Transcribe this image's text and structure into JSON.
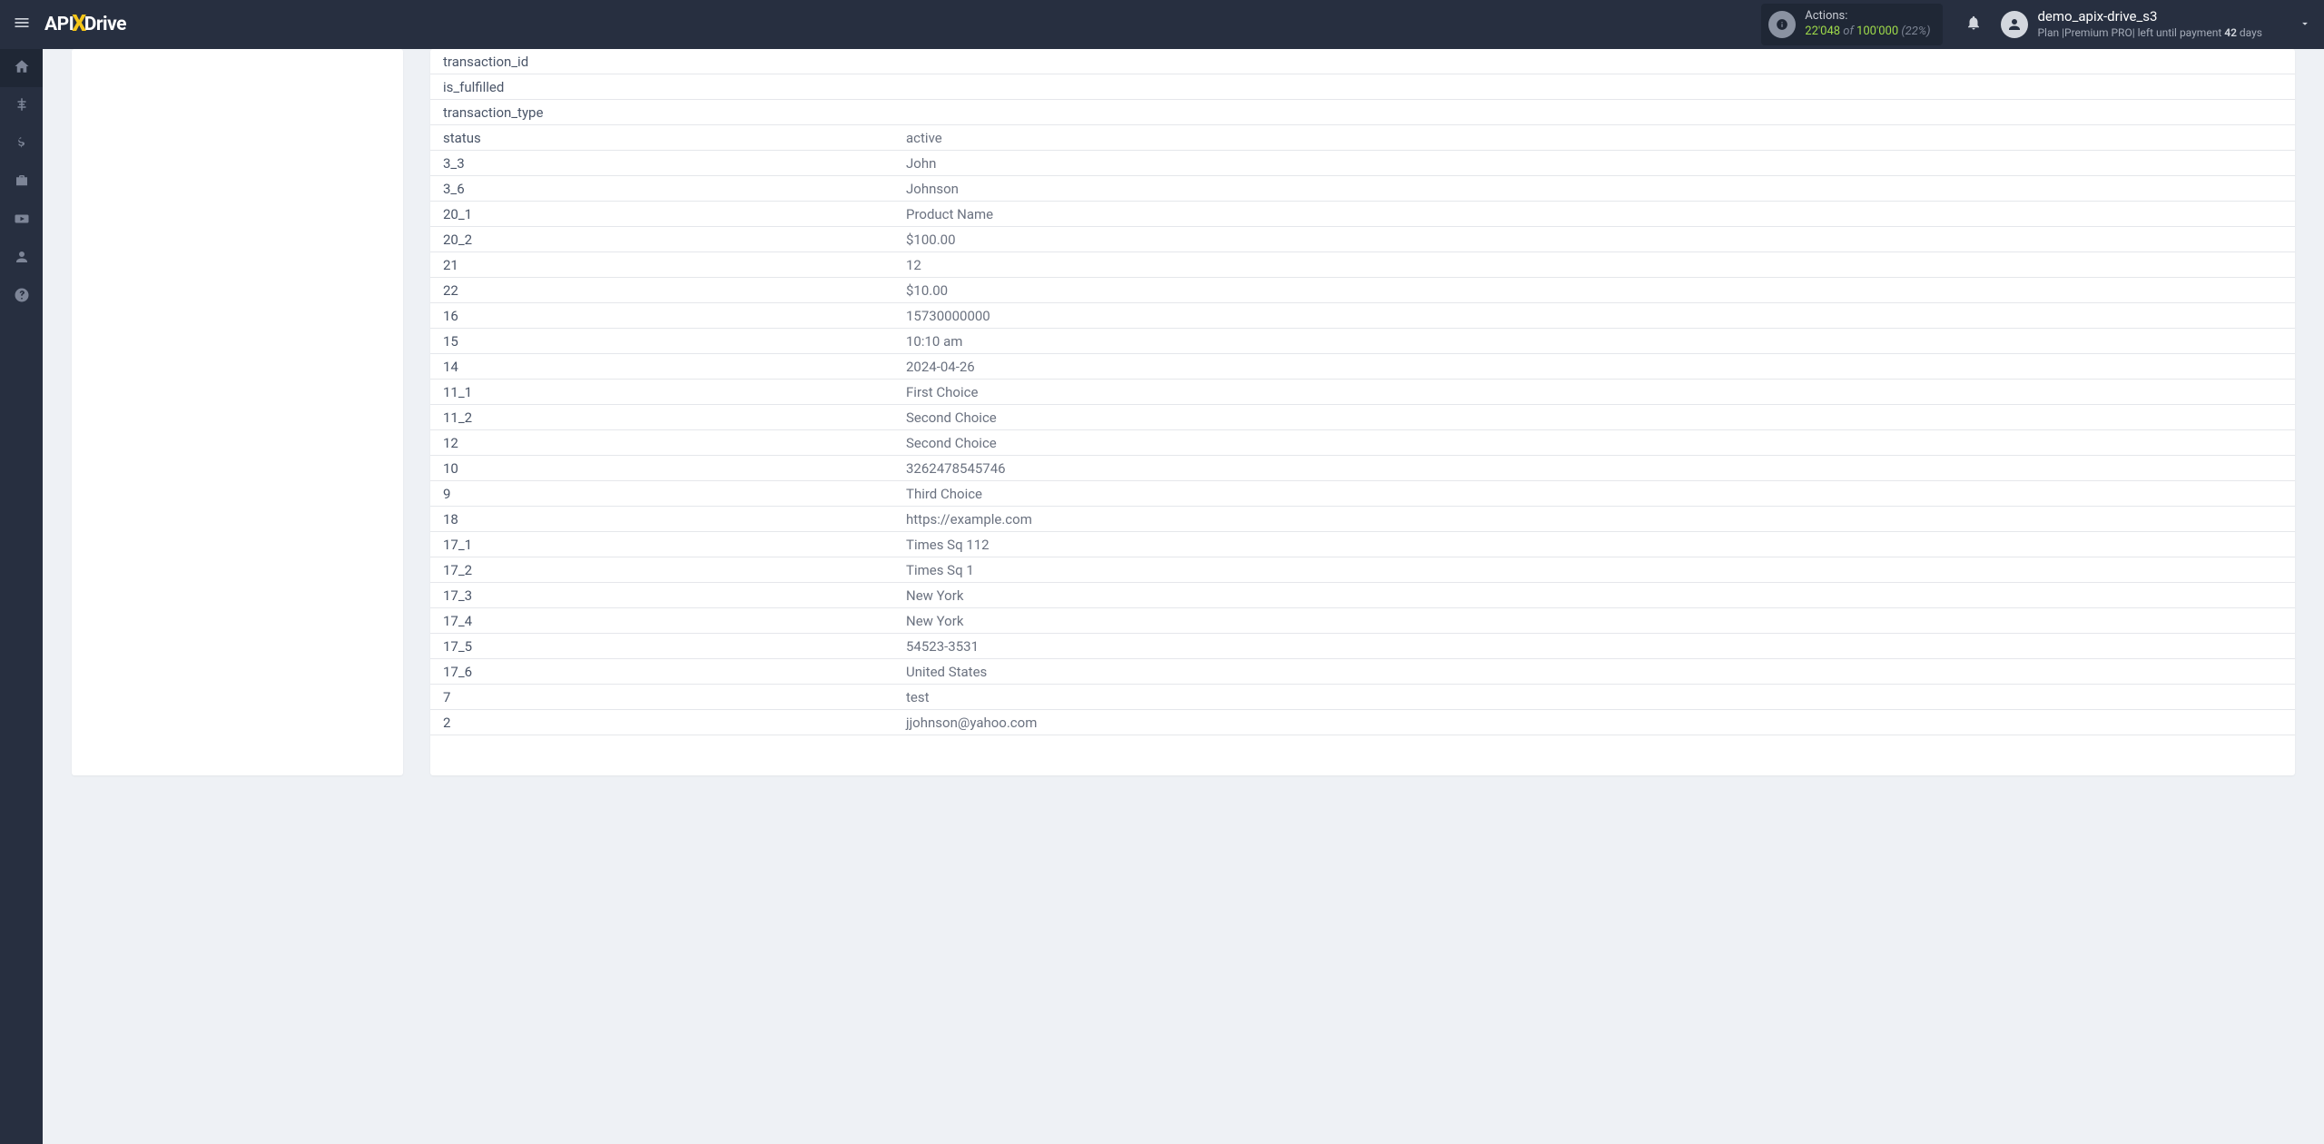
{
  "header": {
    "logo": {
      "part1": "API",
      "x": "X",
      "part2": "Drive"
    },
    "actions": {
      "label": "Actions:",
      "current": "22'048",
      "of": " of ",
      "max": "100'000",
      "pct": " (22%)"
    },
    "user": {
      "name": "demo_apix-drive_s3",
      "plan_prefix": "Plan |",
      "plan_name": "Premium PRO",
      "plan_mid": "| left until payment ",
      "days_num": "42",
      "days_suffix": " days"
    }
  },
  "rows": [
    {
      "key": "transaction_id",
      "val": ""
    },
    {
      "key": "is_fulfilled",
      "val": ""
    },
    {
      "key": "transaction_type",
      "val": ""
    },
    {
      "key": "status",
      "val": "active"
    },
    {
      "key": "3_3",
      "val": "John"
    },
    {
      "key": "3_6",
      "val": "Johnson"
    },
    {
      "key": "20_1",
      "val": "Product Name"
    },
    {
      "key": "20_2",
      "val": "$100.00"
    },
    {
      "key": "21",
      "val": "12"
    },
    {
      "key": "22",
      "val": "$10.00"
    },
    {
      "key": "16",
      "val": "15730000000"
    },
    {
      "key": "15",
      "val": "10:10 am"
    },
    {
      "key": "14",
      "val": "2024-04-26"
    },
    {
      "key": "11_1",
      "val": "First Choice"
    },
    {
      "key": "11_2",
      "val": "Second Choice"
    },
    {
      "key": "12",
      "val": "Second Choice"
    },
    {
      "key": "10",
      "val": "3262478545746"
    },
    {
      "key": "9",
      "val": "Third Choice"
    },
    {
      "key": "18",
      "val": "https://example.com"
    },
    {
      "key": "17_1",
      "val": "Times Sq 112"
    },
    {
      "key": "17_2",
      "val": "Times Sq 1"
    },
    {
      "key": "17_3",
      "val": "New York"
    },
    {
      "key": "17_4",
      "val": "New York"
    },
    {
      "key": "17_5",
      "val": "54523-3531"
    },
    {
      "key": "17_6",
      "val": "United States"
    },
    {
      "key": "7",
      "val": "test"
    },
    {
      "key": "2",
      "val": "jjohnson@yahoo.com"
    }
  ]
}
